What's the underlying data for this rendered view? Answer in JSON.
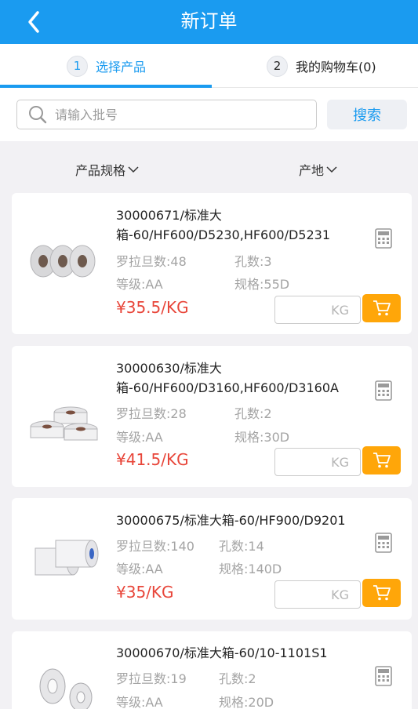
{
  "header": {
    "title": "新订单"
  },
  "steps": [
    {
      "num": "1",
      "label": "选择产品"
    },
    {
      "num": "2",
      "label": "我的购物车(0)"
    }
  ],
  "search": {
    "placeholder": "请输入批号",
    "button": "搜索"
  },
  "filters": {
    "spec": "产品规格",
    "origin": "产地"
  },
  "products": [
    {
      "name": "30000671/标准大箱-60/HF600/D5230,HF600/D5231",
      "denier": "罗拉旦数:48",
      "holes": "孔数:3",
      "grade": "等级:AA",
      "spec": "规格:55D",
      "price": "¥35.5/KG",
      "unit": "KG"
    },
    {
      "name": "30000630/标准大箱-60/HF600/D3160,HF600/D3160A",
      "denier": "罗拉旦数:28",
      "holes": "孔数:2",
      "grade": "等级:AA",
      "spec": "规格:30D",
      "price": "¥41.5/KG",
      "unit": "KG"
    },
    {
      "name": "30000675/标准大箱-60/HF900/D9201",
      "denier": "罗拉旦数:140",
      "holes": "孔数:14",
      "grade": "等级:AA",
      "spec": "规格:140D",
      "price": "¥35/KG",
      "unit": "KG"
    },
    {
      "name": "30000670/标准大箱-60/10-1101S1",
      "denier": "罗拉旦数:19",
      "holes": "孔数:2",
      "grade": "等级:AA",
      "spec": "规格:20D"
    }
  ],
  "colors": {
    "brand": "#1a9bf0",
    "price": "#e8463a",
    "cart": "#ffa609"
  },
  "icons": [
    "back-arrow-icon",
    "search-icon",
    "chevron-down-icon",
    "calculator-icon",
    "cart-icon"
  ]
}
